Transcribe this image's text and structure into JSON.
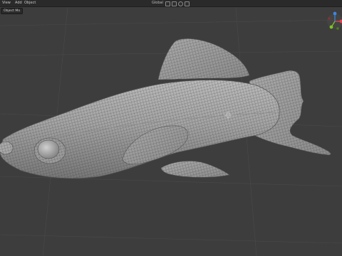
{
  "menu": [
    "View",
    "Add",
    "Object"
  ],
  "mode_chip": "Object Mo",
  "toolbar": {
    "orientation": "Global",
    "snap_icon": "magnet-icon",
    "proportional_icon": "proportional-edit-icon"
  },
  "gizmo": {
    "axes": [
      "X",
      "Y",
      "Z"
    ],
    "colors": {
      "x": "#e8414e",
      "y": "#7fc31f",
      "z": "#3d86e0"
    }
  },
  "viewport": {
    "background": "#3d3d3d",
    "object": "fish-mesh"
  }
}
